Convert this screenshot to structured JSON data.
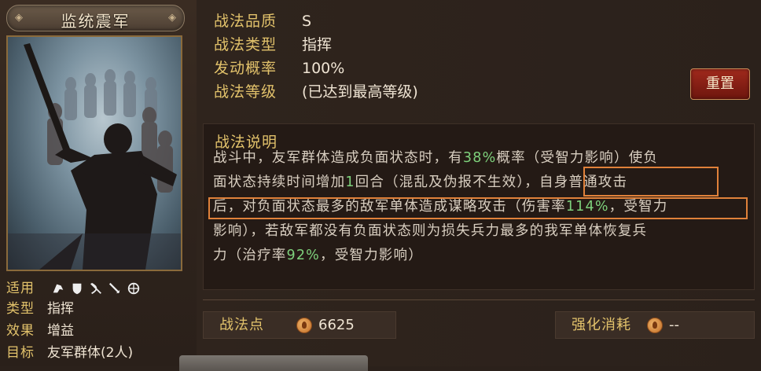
{
  "skill": {
    "name": "监统震军",
    "attributes": [
      {
        "key": "战法品质",
        "value": "S"
      },
      {
        "key": "战法类型",
        "value": "指挥"
      },
      {
        "key": "发动概率",
        "value": "100%"
      },
      {
        "key": "战法等级",
        "value": "(已达到最高等级)"
      }
    ],
    "reset_label": "重置"
  },
  "meta": {
    "applicable_key": "适用",
    "applicable_icons": [
      "cavalry-icon",
      "shield-icon",
      "bow-icon",
      "spear-icon",
      "chariot-icon"
    ],
    "type_key": "类型",
    "type_value": "指挥",
    "effect_key": "效果",
    "effect_value": "增益",
    "target_key": "目标",
    "target_value": "友军群体(2人)"
  },
  "description": {
    "heading": "战法说明",
    "lines": [
      [
        {
          "t": "战斗中，友军群体造成负面状态时，有"
        },
        {
          "t": "38%",
          "g": true
        },
        {
          "t": "概率（受智力影响）使负"
        }
      ],
      [
        {
          "t": "面状态持续时间增加"
        },
        {
          "t": "1",
          "g": true
        },
        {
          "t": "回合（混乱及伪报不生效），自身普通攻击"
        }
      ],
      [
        {
          "t": "后，对负面状态最多的敌军单体造成谋略攻击（伤害率"
        },
        {
          "t": "114%",
          "g": true
        },
        {
          "t": "，受智力"
        }
      ],
      [
        {
          "t": "影响），若敌军都没有负面状态则为损失兵力最多的我军单体恢复兵"
        }
      ],
      [
        {
          "t": "力（治疗率"
        },
        {
          "t": "92%",
          "g": true
        },
        {
          "t": "，受智力影响）"
        }
      ]
    ]
  },
  "stats": {
    "points_label": "战法点",
    "points_value": "6625",
    "cost_label": "强化消耗",
    "cost_value": "--"
  },
  "colors": {
    "gold": "#e2c26b",
    "green": "#7ed17c",
    "highlight": "#e0813a",
    "reset_red": "#8f2216"
  }
}
